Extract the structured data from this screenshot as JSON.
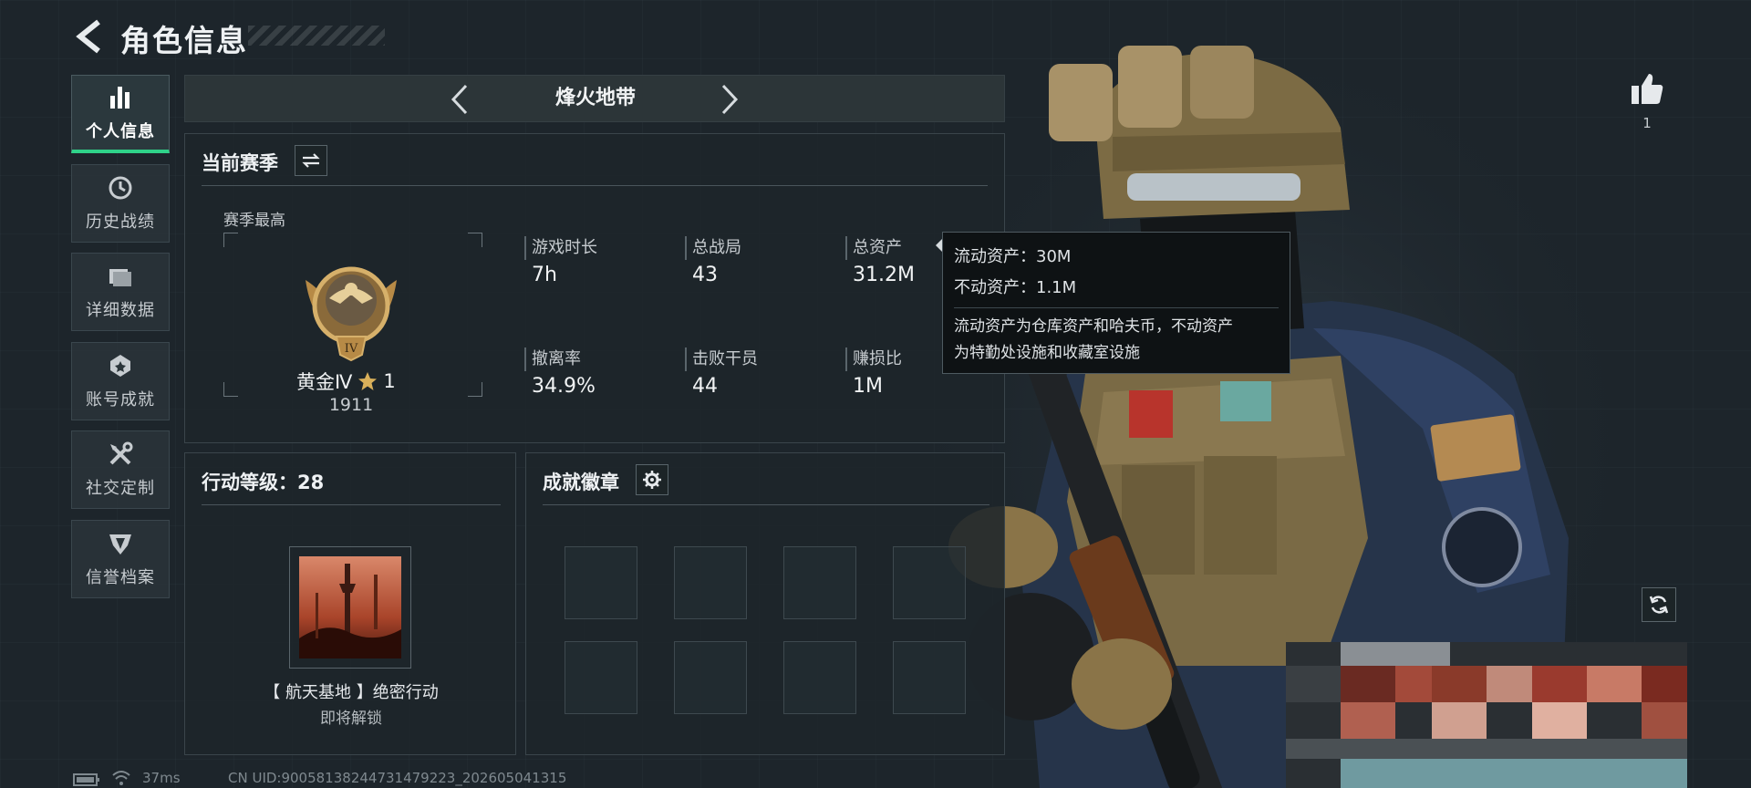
{
  "header": {
    "title": "角色信息"
  },
  "sidebar": {
    "items": [
      {
        "label": "个人信息",
        "icon": "bar-chart-icon",
        "active": true
      },
      {
        "label": "历史战绩",
        "icon": "history-clock-icon",
        "active": false
      },
      {
        "label": "详细数据",
        "icon": "folder-icon",
        "active": false
      },
      {
        "label": "账号成就",
        "icon": "achievement-icon",
        "active": false
      },
      {
        "label": "社交定制",
        "icon": "tools-icon",
        "active": false
      },
      {
        "label": "信誉档案",
        "icon": "reputation-icon",
        "active": false
      }
    ]
  },
  "mode_selector": {
    "label": "烽火地带"
  },
  "season_panel": {
    "title": "当前赛季",
    "season_best_label": "赛季最高",
    "rank": {
      "name": "黄金Ⅳ",
      "stars": "1",
      "score": "1911",
      "emblem_numeral": "IV"
    },
    "stats": [
      {
        "label": "游戏时长",
        "value": "7h"
      },
      {
        "label": "总战局",
        "value": "43"
      },
      {
        "label": "总资产",
        "value": "31.2M"
      },
      {
        "label": "撤离率",
        "value": "34.9%"
      },
      {
        "label": "击败干员",
        "value": "44"
      },
      {
        "label": "赚损比",
        "value": "1M"
      }
    ]
  },
  "tooltip": {
    "liquid": "流动资产：30M",
    "fixed": "不动资产：1.1M",
    "desc_line1": "流动资产为仓库资产和哈夫币，不动资产",
    "desc_line2": "为特勤处设施和收藏室设施"
  },
  "action_panel": {
    "title": "行动等级：28",
    "mission_name": "【 航天基地 】绝密行动",
    "mission_status": "即将解锁"
  },
  "achievement_panel": {
    "title": "成就徽章",
    "slot_count": 8
  },
  "likes": {
    "count": "1"
  },
  "status_bar": {
    "ping": "37ms",
    "uid": "CN UID:9005813824473147​9223_202605041315"
  },
  "colors": {
    "accent": "#2fd289",
    "gold": "#c9a25a",
    "background": "#1d252b"
  }
}
